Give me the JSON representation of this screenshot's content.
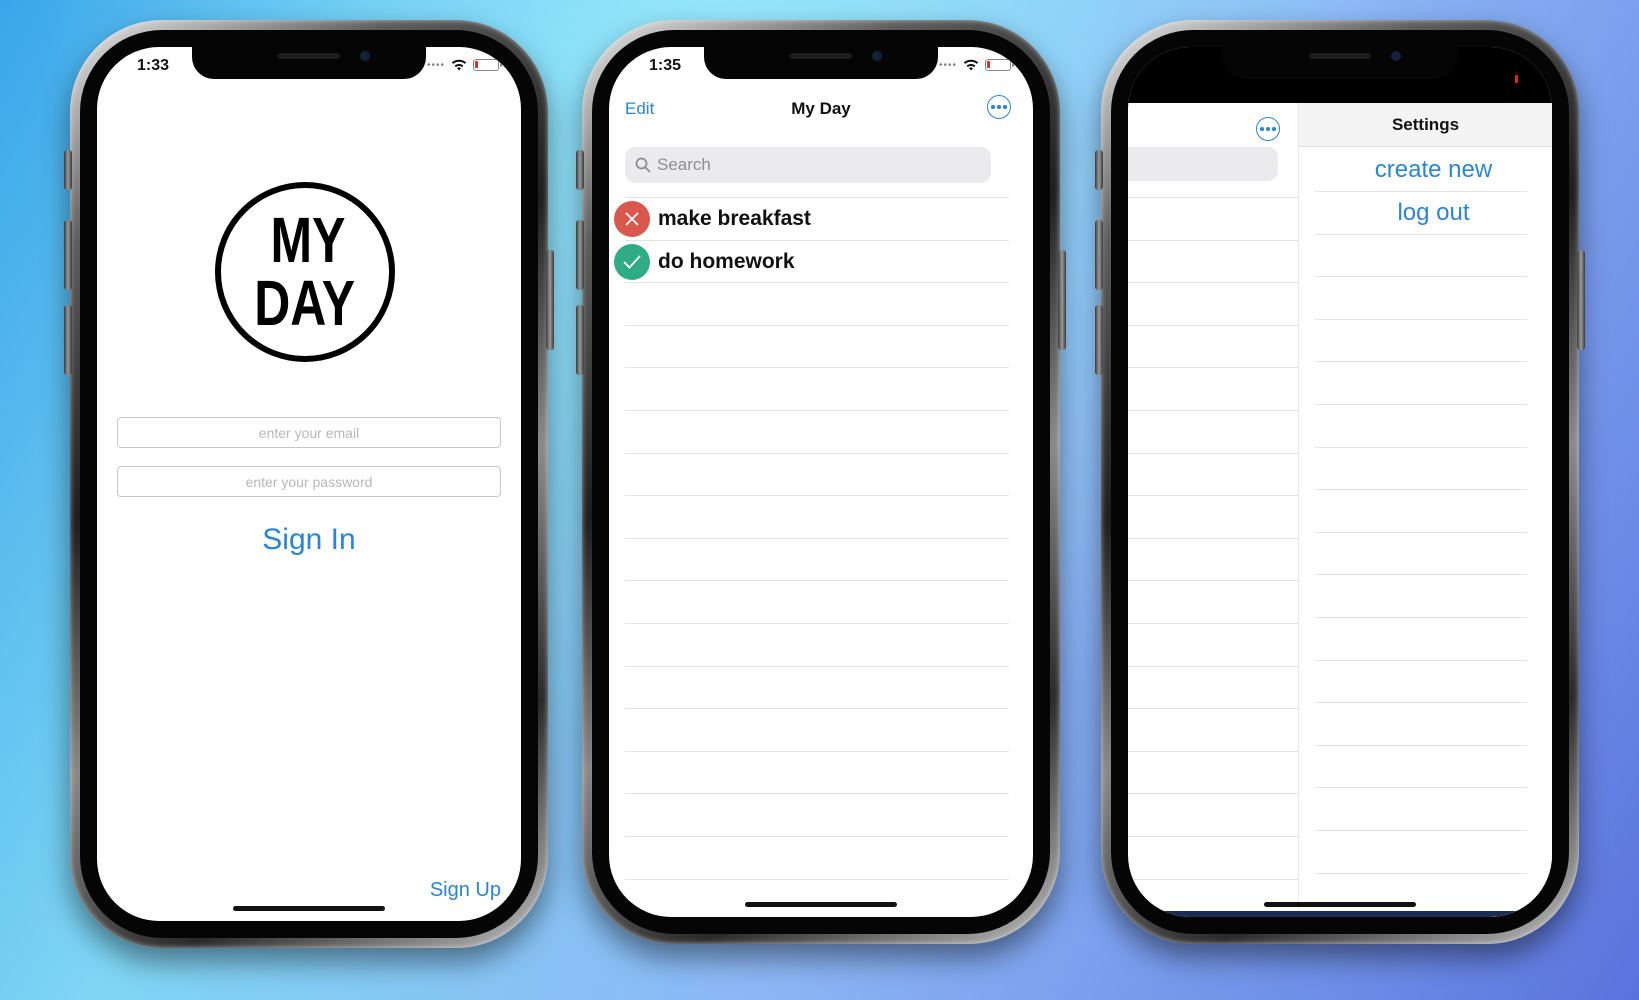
{
  "phone1": {
    "time": "1:33",
    "logo": {
      "line1": "MY",
      "line2": "DAY"
    },
    "email": {
      "placeholder": "enter your email"
    },
    "password": {
      "placeholder": "enter your password"
    },
    "sign_in_label": "Sign In",
    "sign_up_label": "Sign Up"
  },
  "phone2": {
    "time": "1:35",
    "edit_label": "Edit",
    "title": "My Day",
    "more_icon": "ellipsis-circle-icon",
    "search": {
      "placeholder": "Search"
    },
    "tasks": [
      {
        "label": "make breakfast",
        "status": "incomplete",
        "icon": "x-mark-icon",
        "color": "#d9574c"
      },
      {
        "label": "do homework",
        "status": "complete",
        "icon": "checkmark-icon",
        "color": "#2fab86"
      }
    ]
  },
  "phone3": {
    "more_icon": "ellipsis-circle-icon",
    "settings_title": "Settings",
    "items": [
      {
        "label": "create new"
      },
      {
        "label": "log out"
      }
    ]
  },
  "colors": {
    "accent": "#2a84d8",
    "incomplete": "#d9574c",
    "complete": "#2fab86",
    "battery_low": "#e32b2b"
  }
}
